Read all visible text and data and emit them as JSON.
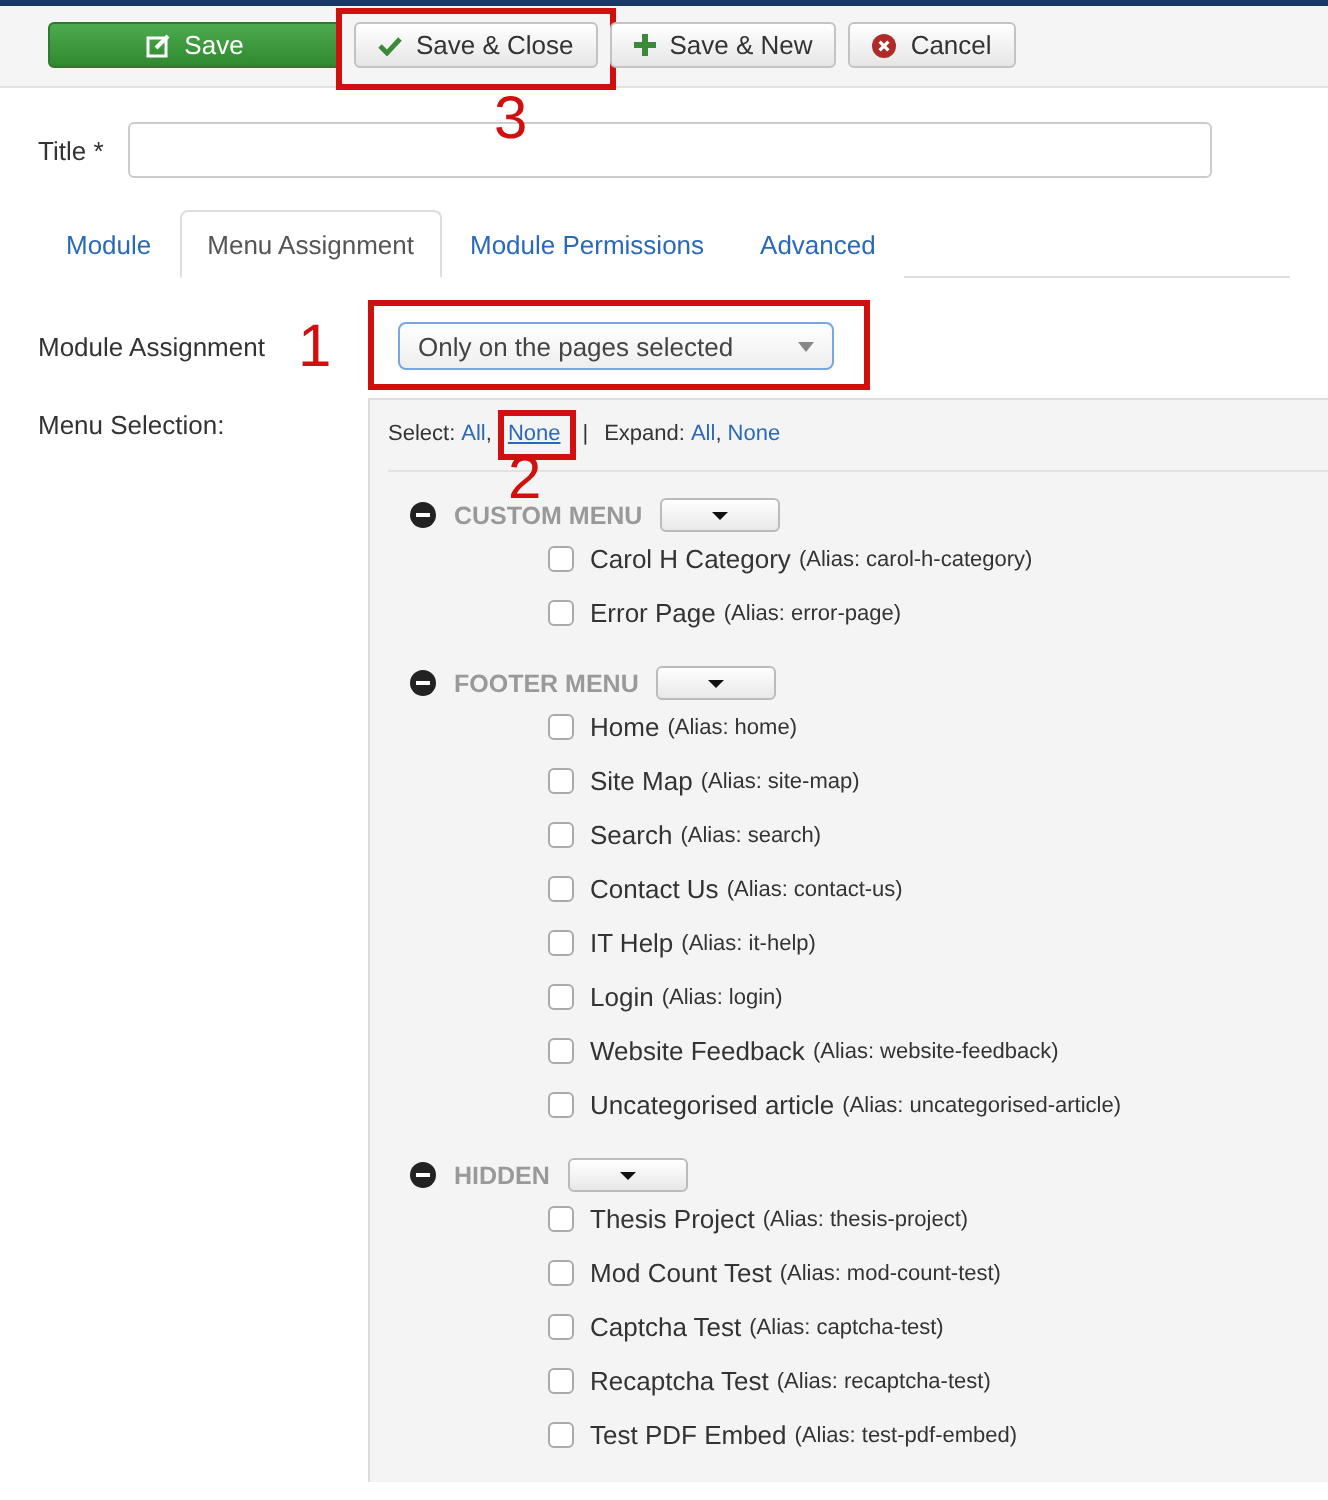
{
  "toolbar": {
    "buttons": [
      {
        "kind": "save",
        "label": "Save"
      },
      {
        "kind": "check",
        "label": "Save & Close",
        "annotation": "3"
      },
      {
        "kind": "plus",
        "label": "Save & New"
      },
      {
        "kind": "cancel",
        "label": "Cancel"
      }
    ]
  },
  "title_field": {
    "label": "Title *"
  },
  "tabs": [
    {
      "label": "Module",
      "selected": false
    },
    {
      "label": "Menu Assignment",
      "selected": true
    },
    {
      "label": "Module Permissions",
      "selected": false
    },
    {
      "label": "Advanced",
      "selected": false
    }
  ],
  "module_assignment": {
    "label": "Module Assignment",
    "value": "Only on the pages selected",
    "annotation": "1"
  },
  "menu_selection": {
    "label": "Menu Selection:",
    "controls": [
      {
        "kind": "text",
        "text": "Select:"
      },
      {
        "kind": "link",
        "text": "All"
      },
      {
        "kind": "text",
        "text": ","
      },
      {
        "kind": "link",
        "text": "None",
        "annotation": "2"
      },
      {
        "kind": "text",
        "text": "|"
      },
      {
        "kind": "text",
        "text": "Expand:"
      },
      {
        "kind": "link",
        "text": "All"
      },
      {
        "kind": "text",
        "text": ","
      },
      {
        "kind": "link",
        "text": "None"
      }
    ],
    "menus": [
      {
        "name": "CUSTOM MENU",
        "expanded": true,
        "children": [
          {
            "title": "Carol H Category",
            "alias": "(Alias: carol-h-category)",
            "checked": false
          },
          {
            "title": "Error Page",
            "alias": "(Alias: error-page)",
            "checked": false
          }
        ]
      },
      {
        "name": "FOOTER MENU",
        "expanded": true,
        "children": [
          {
            "title": "Home",
            "alias": "(Alias: home)",
            "checked": false
          },
          {
            "title": "Site Map",
            "alias": "(Alias: site-map)",
            "checked": false
          },
          {
            "title": "Search",
            "alias": "(Alias: search)",
            "checked": false
          },
          {
            "title": "Contact Us",
            "alias": "(Alias: contact-us)",
            "checked": false
          },
          {
            "title": "IT Help",
            "alias": "(Alias: it-help)",
            "checked": false
          },
          {
            "title": "Login",
            "alias": "(Alias: login)",
            "checked": false
          },
          {
            "title": "Website Feedback",
            "alias": "(Alias: website-feedback)",
            "checked": false
          },
          {
            "title": "Uncategorised article",
            "alias": "(Alias: uncategorised-article)",
            "checked": false
          }
        ]
      },
      {
        "name": "HIDDEN",
        "expanded": true,
        "children": [
          {
            "title": "Thesis Project",
            "alias": "(Alias: thesis-project)",
            "checked": false
          },
          {
            "title": "Mod Count Test",
            "alias": "(Alias: mod-count-test)",
            "checked": false
          },
          {
            "title": "Captcha Test",
            "alias": "(Alias: captcha-test)",
            "checked": false
          },
          {
            "title": "Recaptcha Test",
            "alias": "(Alias: recaptcha-test)",
            "checked": false
          },
          {
            "title": "Test PDF Embed",
            "alias": "(Alias: test-pdf-embed)",
            "checked": false
          }
        ]
      }
    ]
  }
}
